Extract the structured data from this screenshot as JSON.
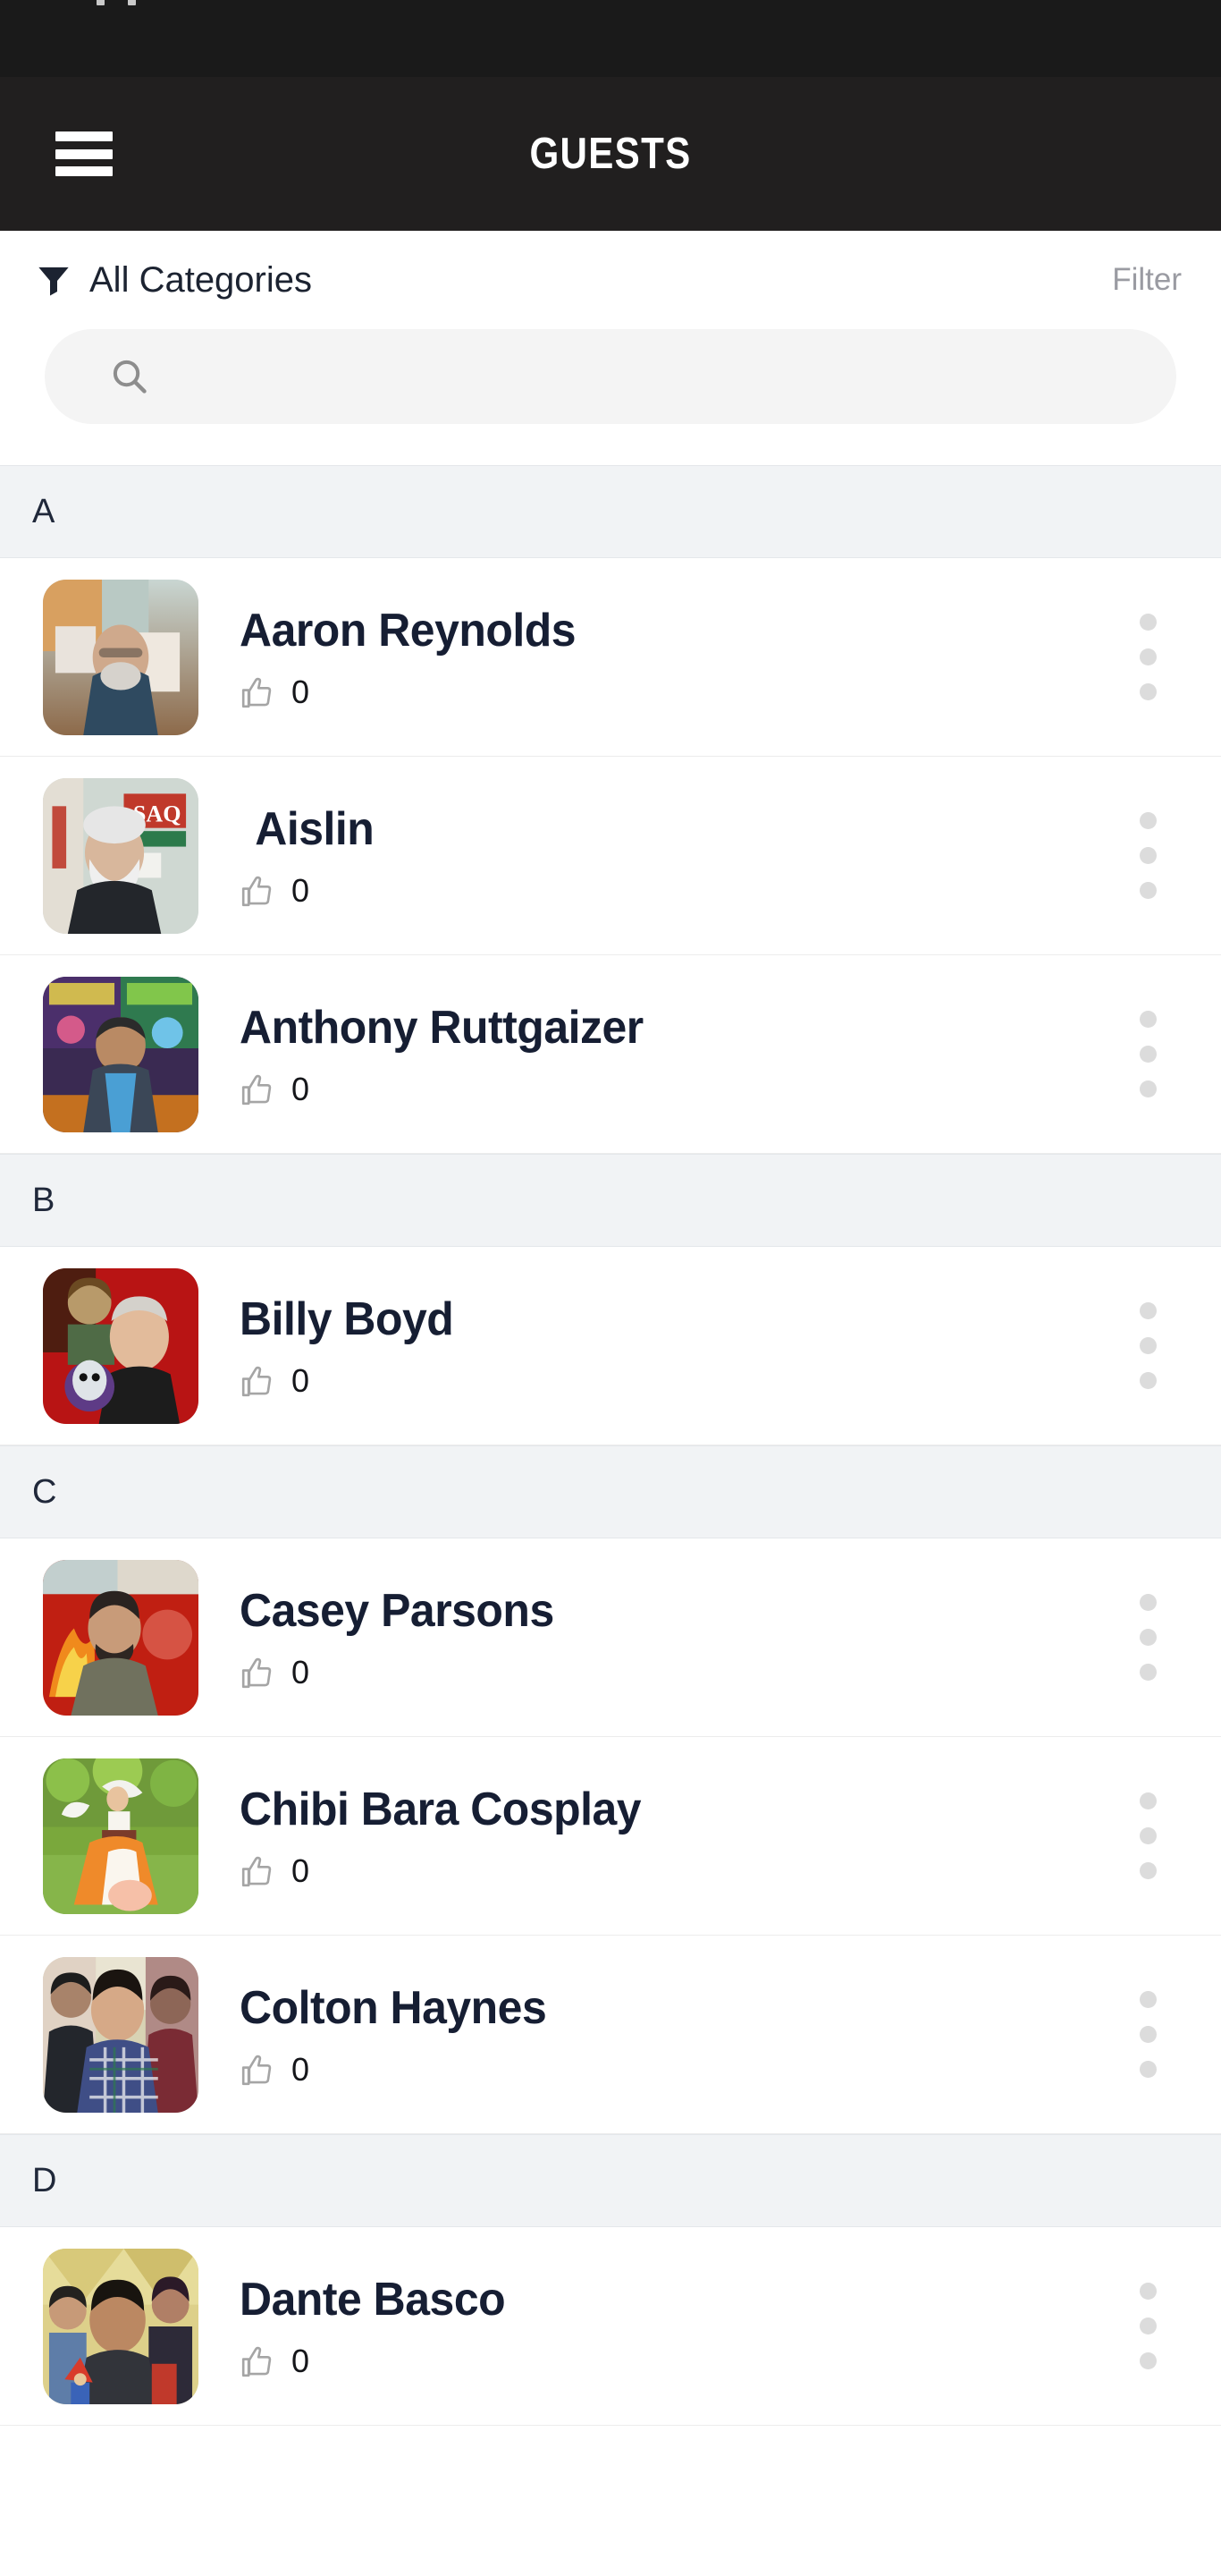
{
  "statusbar": {
    "bg": "#1a1a1a"
  },
  "appbar": {
    "title": "GUESTS",
    "menu_icon": "hamburger-menu-icon",
    "bg": "#211f1f"
  },
  "filterbar": {
    "icon": "funnel-filter-icon",
    "category_label": "All Categories",
    "filter_label": "Filter"
  },
  "search": {
    "icon": "search-icon",
    "value": "",
    "placeholder": ""
  },
  "sections": [
    {
      "letter": "A",
      "guests": [
        {
          "name": "Aaron Reynolds",
          "likes": "0",
          "indent": false
        },
        {
          "name": "Aislin",
          "likes": "0",
          "indent": true
        },
        {
          "name": "Anthony Ruttgaizer",
          "likes": "0",
          "indent": false
        }
      ]
    },
    {
      "letter": "B",
      "guests": [
        {
          "name": "Billy Boyd",
          "likes": "0",
          "indent": false
        }
      ]
    },
    {
      "letter": "C",
      "guests": [
        {
          "name": "Casey Parsons",
          "likes": "0",
          "indent": false
        },
        {
          "name": "Chibi Bara Cosplay",
          "likes": "0",
          "indent": false
        },
        {
          "name": "Colton Haynes",
          "likes": "0",
          "indent": false
        }
      ]
    },
    {
      "letter": "D",
      "guests": [
        {
          "name": "Dante Basco",
          "likes": "0",
          "indent": false
        }
      ]
    }
  ],
  "icons": {
    "like": "thumbs-up-icon",
    "overflow": "three-dot-menu-icon"
  },
  "colors": {
    "appbar_bg": "#211f1f",
    "section_bg": "#f1f3f5",
    "name_text": "#161e33",
    "muted_text": "#9a9ba2",
    "search_bg": "#f4f4f4"
  }
}
